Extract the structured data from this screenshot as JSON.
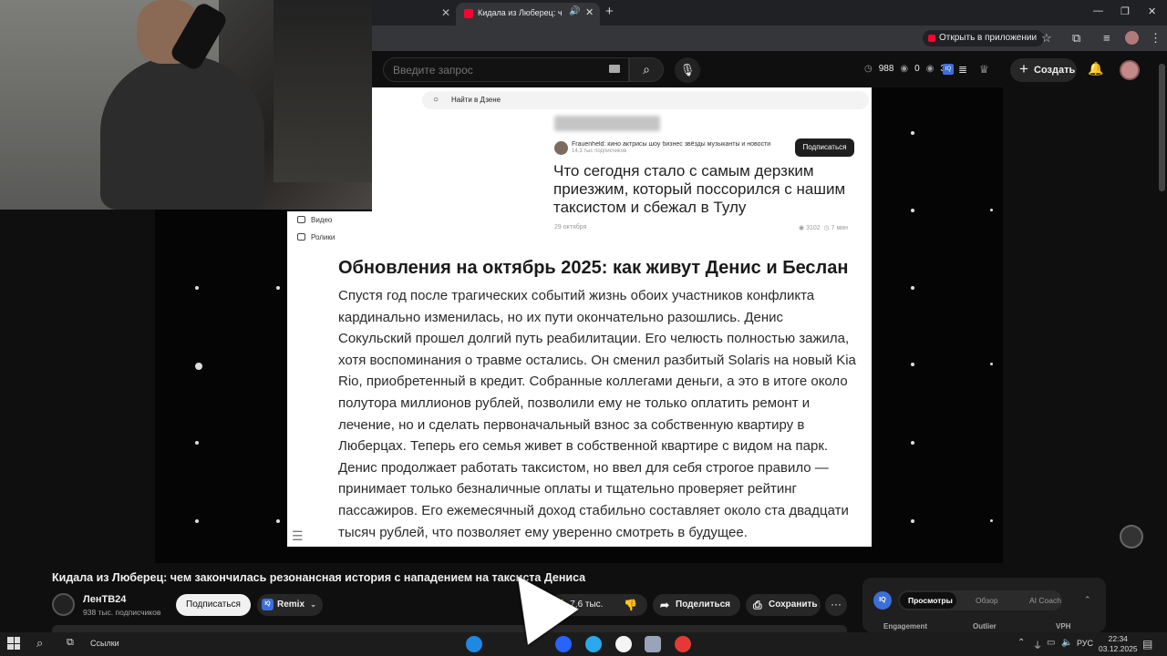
{
  "browser": {
    "tab_title": "Кидала из Люберец: чем з",
    "open_in_app": "Открыть в приложении"
  },
  "header": {
    "search_placeholder": "Введите запрос",
    "stats": [
      "988",
      "0",
      "3"
    ],
    "create_label": "Создать"
  },
  "dzen": {
    "search_placeholder": "Найти в Дзене",
    "channel_name": "Frauenheld: кино актрисы шоу бизнес звёзды музыканты и новости",
    "channel_subs": "14,3 тыс подписчиков",
    "subscribe_label": "Подписаться",
    "teaser_title": "Что сегодня стало с самым дерзким приезжим, который поссорился с нашим таксистом и сбежал в Тулу",
    "teaser_date": "29 октября",
    "teaser_views": "3102",
    "teaser_read": "7 мин",
    "nav_video": "Видео",
    "nav_clips": "Ролики",
    "article_heading": "Обновления на октябрь 2025: как живут Денис и Беслан",
    "article_body": "Спустя год после трагических событий жизнь обоих участников конфликта кардинально изменилась, но их пути окончательно разошлись. Денис Сокульский прошел долгий путь реабилитации. Его челюсть полностью зажила, хотя воспоминания о травме остались. Он сменил разбитый Solaris на новый Kia Rio, приобретенный в кредит. Собранные коллегами деньги, а это в итоге около полутора миллионов рублей, позволили ему не только оплатить ремонт и лечение, но и сделать первоначальный взнос за собственную квартиру в Люберцах. Теперь его семья живет в собственной квартире с видом на парк. Денис продолжает работать таксистом, но ввел для себя строгое правило — принимает только безналичные оплаты и тщательно проверяет рейтинг пассажиров. Его ежемесячный доход стабильно составляет около ста двадцати тысяч рублей, что позволяет ему уверенно смотреть в будущее."
  },
  "video": {
    "title": "Кидала из Люберец: чем закончилась резонансная история с нападением на таксиста Дениса",
    "channel_name": "ЛенТВ24",
    "channel_subs": "938 тыс. подписчиков",
    "subscribe_label": "Подписаться",
    "remix_label": "Remix",
    "likes": "7,6 тыс.",
    "share_label": "Поделиться",
    "save_label": "Сохранить"
  },
  "iq_panel": {
    "tabs": [
      "Просмотры",
      "Обзор",
      "AI Coach"
    ],
    "active_tab": "Просмотры",
    "columns": [
      "Engagement",
      "Outlier",
      "VPH"
    ]
  },
  "taskbar": {
    "links_label": "Ссылки",
    "lang": "РУС",
    "time": "22:34",
    "date": "03.12.2025"
  },
  "colors": {
    "yt_red": "#ff0033",
    "iq_blue": "#3b6fd8",
    "bg": "#0f0f0f"
  }
}
